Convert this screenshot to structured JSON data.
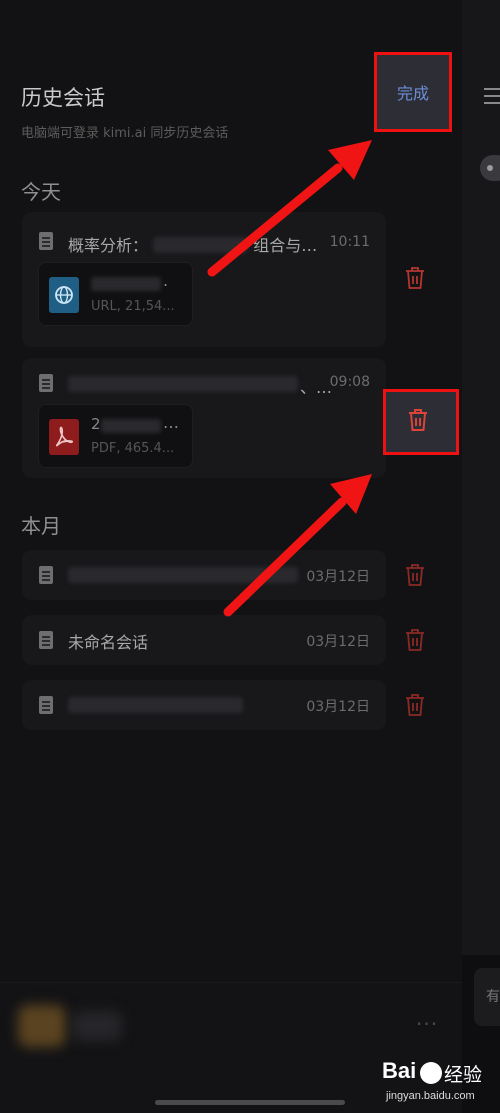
{
  "drawer": {
    "title": "历史会话",
    "subtitle": "电脑端可登录 kimi.ai  同步历史会话",
    "done_label": "完成"
  },
  "sections": {
    "today": "今天",
    "this_month": "本月"
  },
  "today_items": [
    {
      "title_prefix": "概率分析：",
      "title_suffix": "组合与…",
      "time": "10:11",
      "attachment": {
        "type": "web",
        "name_suffix": ".",
        "meta": "URL, 21,54..."
      }
    },
    {
      "title_suffix": "、…",
      "time": "09:08",
      "attachment": {
        "type": "pdf",
        "name_prefix": "2",
        "name_suffix": "…",
        "meta": "PDF, 465.4..."
      }
    }
  ],
  "month_items": [
    {
      "title": "",
      "time": "03月12日"
    },
    {
      "title": "未命名会话",
      "time": "03月12日"
    },
    {
      "title": "",
      "time": "03月12日"
    }
  ],
  "right_peek_label": "有",
  "bottom_more": "···",
  "watermark": {
    "brand": "Bai",
    "brand_cn": "经验",
    "url": "jingyan.baidu.com"
  },
  "colors": {
    "accent_blue": "#6c8fd8",
    "annotation_red": "#e11",
    "trash_red": "#b5362f"
  }
}
